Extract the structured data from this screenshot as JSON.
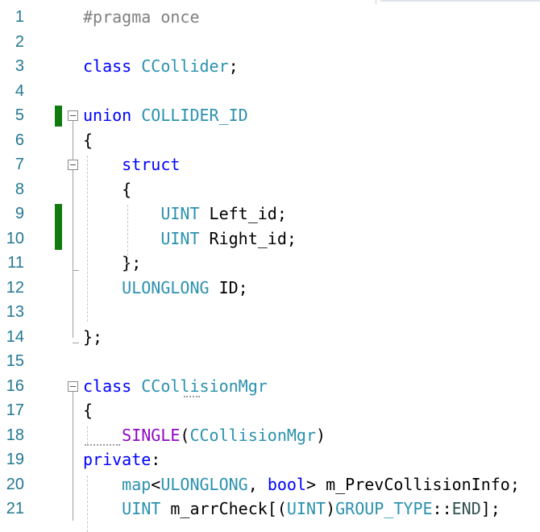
{
  "editor": {
    "lines": [
      {
        "n": "1",
        "segs": [
          {
            "t": "#pragma once",
            "c": "pp"
          }
        ]
      },
      {
        "n": "2",
        "segs": []
      },
      {
        "n": "3",
        "segs": [
          {
            "t": "class",
            "c": "kw"
          },
          {
            "t": " ",
            "c": "op"
          },
          {
            "t": "CCollider",
            "c": "ty"
          },
          {
            "t": ";",
            "c": "op"
          }
        ]
      },
      {
        "n": "4",
        "segs": []
      },
      {
        "n": "5",
        "segs": [
          {
            "t": "union",
            "c": "kw"
          },
          {
            "t": " ",
            "c": "op"
          },
          {
            "t": "COLLIDER_ID",
            "c": "ty"
          }
        ]
      },
      {
        "n": "6",
        "segs": [
          {
            "t": "{",
            "c": "op"
          }
        ]
      },
      {
        "n": "7",
        "segs": [
          {
            "t": "    ",
            "c": "op"
          },
          {
            "t": "struct",
            "c": "kw"
          }
        ]
      },
      {
        "n": "8",
        "segs": [
          {
            "t": "    {",
            "c": "op"
          }
        ]
      },
      {
        "n": "9",
        "segs": [
          {
            "t": "        ",
            "c": "op"
          },
          {
            "t": "UINT",
            "c": "ty"
          },
          {
            "t": " Left_id;",
            "c": "op"
          }
        ]
      },
      {
        "n": "10",
        "segs": [
          {
            "t": "        ",
            "c": "op"
          },
          {
            "t": "UINT",
            "c": "ty"
          },
          {
            "t": " Right_id;",
            "c": "op"
          }
        ]
      },
      {
        "n": "11",
        "segs": [
          {
            "t": "    };",
            "c": "op"
          }
        ]
      },
      {
        "n": "12",
        "segs": [
          {
            "t": "    ",
            "c": "op"
          },
          {
            "t": "ULONGLONG",
            "c": "ty"
          },
          {
            "t": " ID;",
            "c": "op"
          }
        ]
      },
      {
        "n": "13",
        "segs": []
      },
      {
        "n": "14",
        "segs": [
          {
            "t": "};",
            "c": "op"
          }
        ]
      },
      {
        "n": "15",
        "segs": []
      },
      {
        "n": "16",
        "segs": [
          {
            "t": "class",
            "c": "kw"
          },
          {
            "t": " ",
            "c": "op"
          },
          {
            "t": "CCollisionMgr",
            "c": "ty"
          }
        ]
      },
      {
        "n": "17",
        "segs": [
          {
            "t": "{",
            "c": "op"
          }
        ]
      },
      {
        "n": "18",
        "segs": [
          {
            "t": "    ",
            "c": "op"
          },
          {
            "t": "SINGLE",
            "c": "mac"
          },
          {
            "t": "(",
            "c": "op"
          },
          {
            "t": "CCollisionMgr",
            "c": "ty"
          },
          {
            "t": ")",
            "c": "op"
          }
        ]
      },
      {
        "n": "19",
        "segs": [
          {
            "t": "private",
            "c": "kw"
          },
          {
            "t": ":",
            "c": "op"
          }
        ]
      },
      {
        "n": "20",
        "segs": [
          {
            "t": "    ",
            "c": "op"
          },
          {
            "t": "map",
            "c": "ty"
          },
          {
            "t": "<",
            "c": "op"
          },
          {
            "t": "ULONGLONG",
            "c": "ty"
          },
          {
            "t": ", ",
            "c": "op"
          },
          {
            "t": "bool",
            "c": "kw"
          },
          {
            "t": "> m_PrevCollisionInfo;",
            "c": "op"
          }
        ]
      },
      {
        "n": "21",
        "segs": [
          {
            "t": "    ",
            "c": "op"
          },
          {
            "t": "UINT",
            "c": "ty"
          },
          {
            "t": " m_arrCheck[(",
            "c": "op"
          },
          {
            "t": "UINT",
            "c": "ty"
          },
          {
            "t": ")",
            "c": "op"
          },
          {
            "t": "GROUP_TYPE",
            "c": "ty"
          },
          {
            "t": "::",
            "c": "op"
          },
          {
            "t": "END",
            "c": "en"
          },
          {
            "t": "];",
            "c": "op"
          }
        ]
      }
    ]
  },
  "colors": {
    "keyword": "#0000ff",
    "type": "#2b91af",
    "macro": "#8f08c4",
    "preprocessor": "#808080",
    "line_number": "#237893",
    "change_marker": "#107c10"
  }
}
